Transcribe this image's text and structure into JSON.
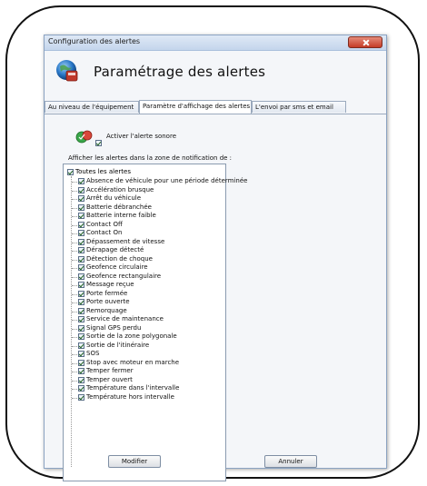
{
  "window": {
    "title": "Configuration des alertes"
  },
  "header": {
    "title": "Paramétrage des alertes"
  },
  "tabs": [
    {
      "label": "Au niveau de l'équipement",
      "active": false
    },
    {
      "label": "Paramètre d'affichage des alertes",
      "active": true
    },
    {
      "label": "L'envoi par sms et email",
      "active": false
    }
  ],
  "sound": {
    "label": "Activer l'alerte sonore",
    "checked": true
  },
  "notification_section": {
    "label": "Afficher les alertes dans la zone de notification de :",
    "root": {
      "label": "Toutes les alertes",
      "checked": true
    },
    "items": [
      {
        "label": "Absence de véhicule pour une période déterminée",
        "checked": true
      },
      {
        "label": "Accélération brusque",
        "checked": true
      },
      {
        "label": "Arrêt du véhicule",
        "checked": true
      },
      {
        "label": "Batterie débranchée",
        "checked": true
      },
      {
        "label": "Batterie interne faible",
        "checked": true
      },
      {
        "label": "Contact Off",
        "checked": true
      },
      {
        "label": "Contact On",
        "checked": true
      },
      {
        "label": "Dépassement de vitesse",
        "checked": true
      },
      {
        "label": "Dérapage détecté",
        "checked": true
      },
      {
        "label": "Détection de choque",
        "checked": true
      },
      {
        "label": "Geofence circulaire",
        "checked": true
      },
      {
        "label": "Geofence rectangulaire",
        "checked": true
      },
      {
        "label": "Message reçue",
        "checked": true
      },
      {
        "label": "Porte fermée",
        "checked": true
      },
      {
        "label": "Porte ouverte",
        "checked": true
      },
      {
        "label": "Remorquage",
        "checked": true
      },
      {
        "label": "Service de maintenance",
        "checked": true
      },
      {
        "label": "Signal GPS perdu",
        "checked": true
      },
      {
        "label": "Sortie de la zone polygonale",
        "checked": true
      },
      {
        "label": "Sortie de l'itinéraire",
        "checked": true
      },
      {
        "label": "SOS",
        "checked": true
      },
      {
        "label": "Stop avec moteur en marche",
        "checked": true
      },
      {
        "label": "Temper fermer",
        "checked": true
      },
      {
        "label": "Temper ouvert",
        "checked": true
      },
      {
        "label": "Température dans l'intervalle",
        "checked": true
      },
      {
        "label": "Température hors intervalle",
        "checked": true
      }
    ]
  },
  "buttons": {
    "modify": "Modifier",
    "cancel": "Annuler"
  }
}
